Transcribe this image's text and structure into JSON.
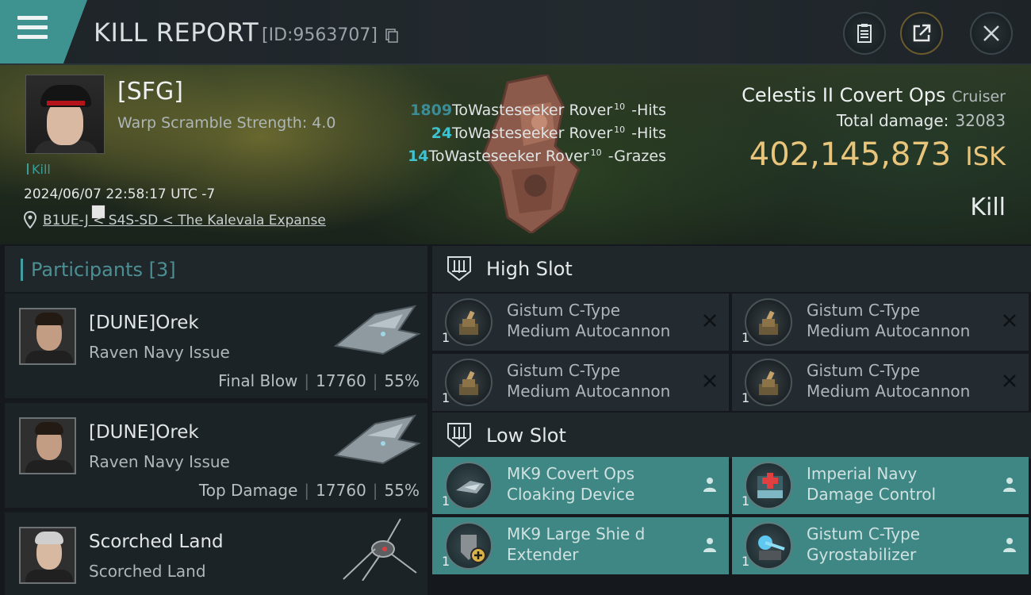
{
  "header": {
    "title": "KILL REPORT",
    "report_id": "[ID:9563707]"
  },
  "victim": {
    "corp": "[SFG]",
    "warp_scramble": "Warp Scramble Strength: 4.0",
    "tag": "Kill",
    "timestamp": "2024/06/07 22:58:17 UTC -7",
    "location": "B1UE-J < S4S-SD < The Kalevala Expanse",
    "ship": "Celestis II Covert Ops",
    "ship_class": "Cruiser",
    "total_damage_label": "Total damage:",
    "total_damage": "32083",
    "isk_value": "402,145,873",
    "isk_unit": "ISK",
    "result": "Kill"
  },
  "hits": [
    {
      "count": "1809",
      "target": "ToWasteseeker Rover",
      "level": "10",
      "result": "-Hits"
    },
    {
      "count": "24",
      "target": "ToWasteseeker Rover",
      "level": "10",
      "result": "-Hits"
    },
    {
      "count": "14",
      "target": "ToWasteseeker Rover",
      "level": "10",
      "result": "-Grazes"
    }
  ],
  "participants": {
    "title": "Participants",
    "count": "[3]",
    "items": [
      {
        "name": "[DUNE]Orek",
        "ship": "Raven Navy Issue",
        "role": "Final Blow",
        "damage": "17760",
        "percent": "55%"
      },
      {
        "name": "[DUNE]Orek",
        "ship": "Raven Navy Issue",
        "role": "Top Damage",
        "damage": "17760",
        "percent": "55%"
      },
      {
        "name": "Scorched Land",
        "ship": "Scorched Land"
      }
    ]
  },
  "slots": {
    "high": {
      "label": "High Slot",
      "modules": [
        {
          "line1": "Gistum C-Type",
          "line2": "Medium Autocannon",
          "qty": "1"
        },
        {
          "line1": "Gistum C-Type",
          "line2": "Medium Autocannon",
          "qty": "1"
        },
        {
          "line1": "Gistum C-Type",
          "line2": "Medium Autocannon",
          "qty": "1"
        },
        {
          "line1": "Gistum C-Type",
          "line2": "Medium Autocannon",
          "qty": "1"
        }
      ]
    },
    "low": {
      "label": "Low Slot",
      "modules": [
        {
          "line1": "MK9 Covert Ops",
          "line2": "Cloaking Device",
          "qty": "1"
        },
        {
          "line1": "Imperial Navy",
          "line2": "Damage Control",
          "qty": "1"
        },
        {
          "line1": "MK9 Large Shie d",
          "line2": "Extender",
          "qty": "1"
        },
        {
          "line1": "Gistum C-Type",
          "line2": "Gyrostabilizer",
          "qty": "1"
        }
      ]
    }
  },
  "colors": {
    "accent": "#3f9fa2",
    "isk": "#e8c57b",
    "hit_count": "#3fc3d0",
    "fitted_module": "#3f8784"
  }
}
